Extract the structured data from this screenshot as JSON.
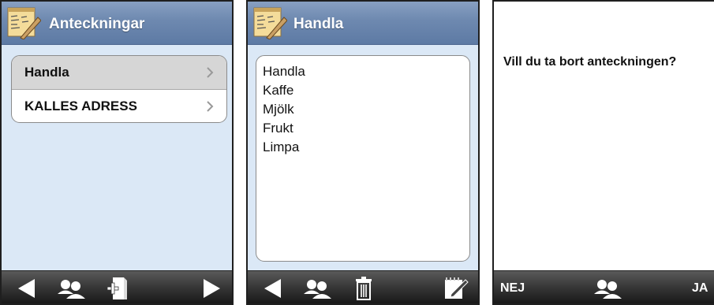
{
  "screens": [
    {
      "title": "Anteckningar",
      "notes": [
        {
          "label": "Handla"
        },
        {
          "label": "KALLES ADRESS"
        }
      ],
      "toolbar": [
        "back-arrow-icon",
        "contacts-icon",
        "new-note-icon",
        "forward-arrow-icon"
      ]
    },
    {
      "title": "Handla",
      "lines": [
        "Handla",
        "Kaffe",
        "Mjölk",
        "Frukt",
        "Limpa"
      ],
      "toolbar": [
        "back-arrow-icon",
        "contacts-icon",
        "trash-icon",
        "edit-note-icon"
      ]
    },
    {
      "question": "Vill du ta bort anteckningen?",
      "no_label": "NEJ",
      "yes_label": "JA"
    }
  ],
  "colors": {
    "title_bar": "#6e89b0",
    "background": "#dbe8f6",
    "toolbar": "#353535",
    "selected_row": "#d6d6d6"
  }
}
